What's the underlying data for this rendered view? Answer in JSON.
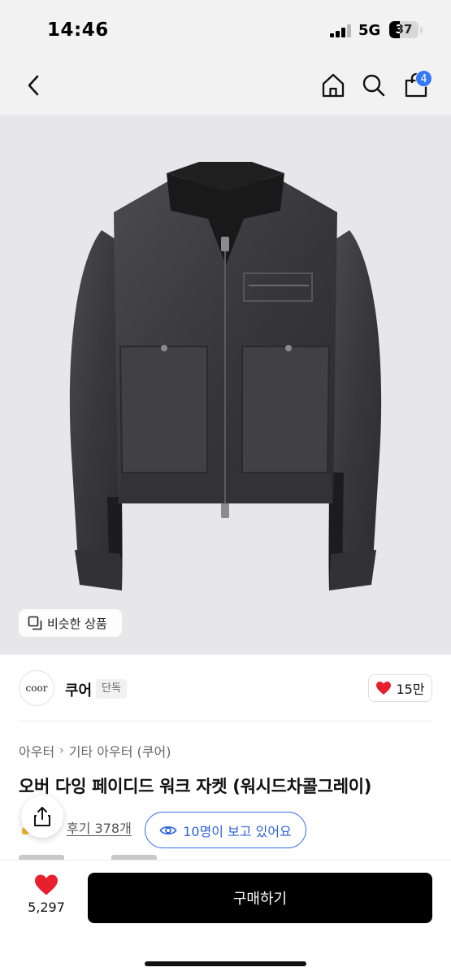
{
  "status_bar": {
    "time": "14:46",
    "network": "5G",
    "battery_percent": 37,
    "battery_label": "37"
  },
  "header": {
    "back_icon": "chevron-left-icon",
    "home_icon": "home-icon",
    "search_icon": "search-icon",
    "cart_icon": "shopping-bag-icon",
    "cart_count": "4"
  },
  "image": {
    "similar_button_label": "비슷한 상품"
  },
  "brand": {
    "logo_text": "coor",
    "name": "쿠어",
    "tag": "단독",
    "like_count": "15만"
  },
  "product": {
    "breadcrumb": [
      "아우터",
      "기타 아우터 (쿠어)"
    ],
    "title": "오버 다잉 페이디드 워크 자켓 (워시드차콜그레이)",
    "review_link": "후기 378개",
    "viewers": "10명이 보고 있어요"
  },
  "bottom_bar": {
    "wish_count": "5,297",
    "buy_label": "구매하기"
  },
  "colors": {
    "accent_blue": "#3478f6",
    "viewers_blue": "#2f63db",
    "heart_red": "#e8202e",
    "buy_button": "#000000",
    "jacket": "#3b3b3f",
    "collar": "#1a1a1a"
  }
}
